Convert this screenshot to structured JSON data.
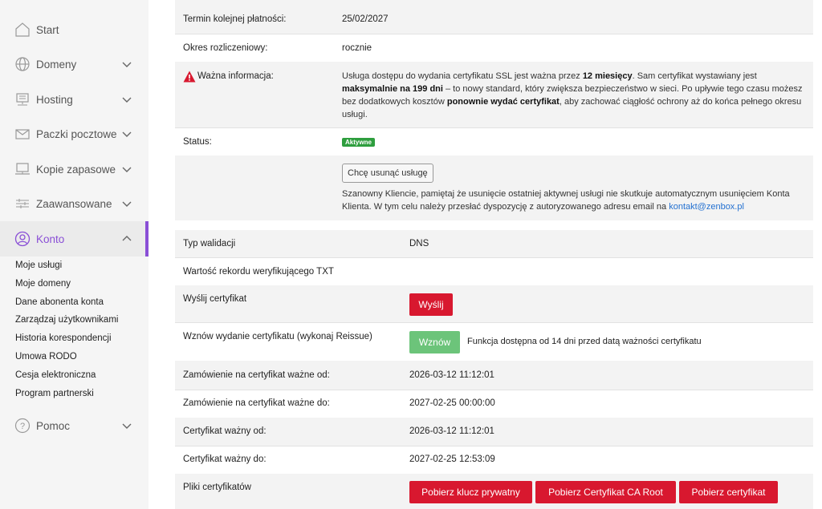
{
  "sidebar": {
    "items": [
      {
        "label": "Start",
        "icon": "home-icon"
      },
      {
        "label": "Domeny",
        "icon": "globe-icon"
      },
      {
        "label": "Hosting",
        "icon": "server-icon"
      },
      {
        "label": "Paczki pocztowe",
        "icon": "mail-icon"
      },
      {
        "label": "Kopie zapasowe",
        "icon": "backup-icon"
      },
      {
        "label": "Zaawansowane",
        "icon": "sliders-icon"
      },
      {
        "label": "Konto",
        "icon": "user-icon"
      },
      {
        "label": "Pomoc",
        "icon": "help-icon"
      }
    ],
    "konto_sub": [
      "Moje usługi",
      "Moje domeny",
      "Dane abonenta konta",
      "Zarządzaj użytkownikami",
      "Historia korespondencji",
      "Umowa RODO",
      "Cesja elektroniczna",
      "Program partnerski"
    ],
    "accent": "#8a4fd6"
  },
  "service": {
    "next_payment_label": "Termin kolejnej płatności:",
    "next_payment_value": "25/02/2027",
    "period_label": "Okres rozliczeniowy:",
    "period_value": "rocznie",
    "important_label": "Ważna informacja:",
    "important_p1": "Usługa dostępu do wydania certyfikatu SSL jest ważna przez ",
    "important_b1": "12 miesięcy",
    "important_p2": ". Sam certyfikat wystawiany jest ",
    "important_b2": "maksymalnie na 199 dni",
    "important_p3": " – to nowy standard, który zwiększa bezpieczeństwo w sieci. Po upływie tego czasu możesz bez dodatkowych kosztów ",
    "important_b3": "ponownie wydać certyfikat",
    "important_p4": ", aby zachować ciągłość ochrony aż do końca pełnego okresu usługi.",
    "status_label": "Status:",
    "status_badge": "Aktywne",
    "remove_button": "Chcę usunąć usługę",
    "remove_note": "Szanowny Kliencie, pamiętaj że usunięcie ostatniej aktywnej usługi nie skutkuje automatycznym usunięciem Konta Klienta. W tym celu należy przesłać dyspozycję z autoryzowanego adresu email na ",
    "remove_email": "kontakt@zenbox.pl"
  },
  "cert": {
    "validation_label": "Typ walidacji",
    "validation_value": "DNS",
    "txt_label": "Wartość rekordu weryfikującego TXT",
    "send_label": "Wyślij certyfikat",
    "send_button": "Wyślij",
    "reissue_label": "Wznów wydanie certyfikatu (wykonaj Reissue)",
    "reissue_button": "Wznów",
    "reissue_note": "Funkcja dostępna od 14 dni przed datą ważności certyfikatu",
    "order_from_label": "Zamówienie na certyfikat ważne od:",
    "order_from_value": "2026-03-12 11:12:01",
    "order_to_label": "Zamówienie na certyfikat ważne do:",
    "order_to_value": "2027-02-25 00:00:00",
    "valid_from_label": "Certyfikat ważny od:",
    "valid_from_value": "2026-03-12 11:12:01",
    "valid_to_label": "Certyfikat ważny do:",
    "valid_to_value": "2027-02-25 12:53:09",
    "files_label": "Pliki certyfikatów",
    "btn_key": "Pobierz klucz prywatny",
    "btn_ca": "Pobierz Certyfikat CA Root",
    "btn_cert": "Pobierz certyfikat"
  }
}
